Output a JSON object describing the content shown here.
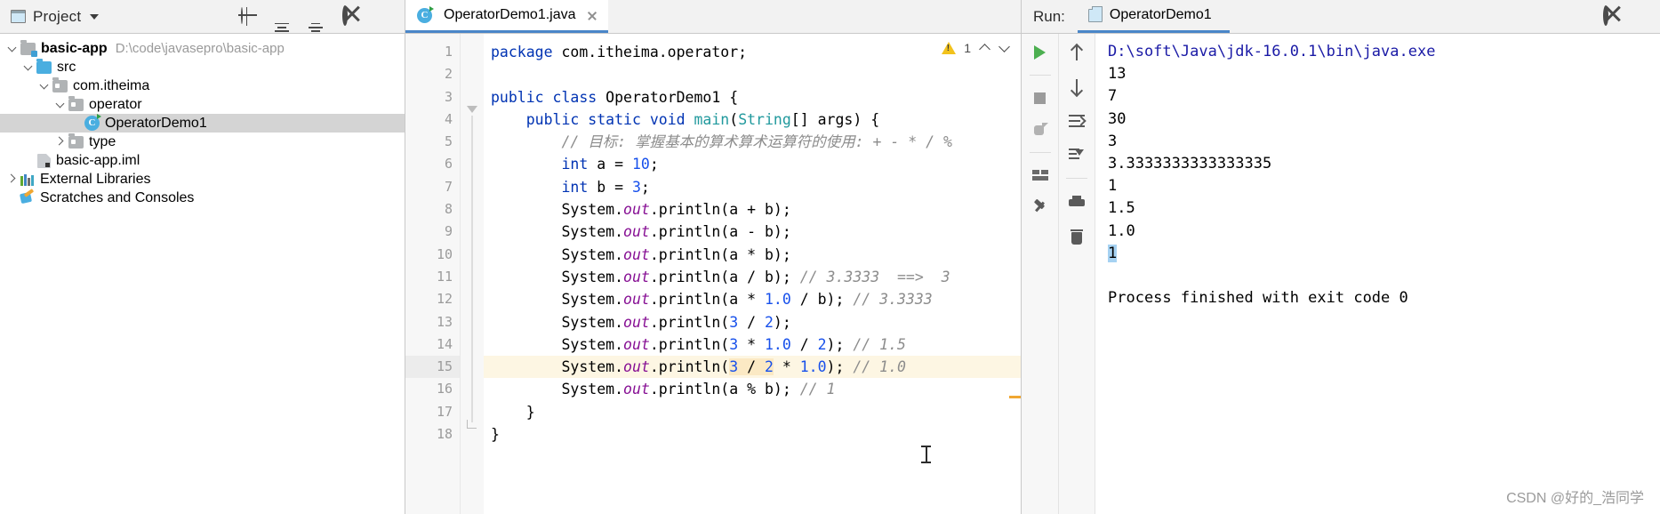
{
  "project_panel": {
    "title": "Project",
    "icons": [
      "window-icon",
      "chevron-down-icon",
      "locate-icon",
      "expand-all-icon",
      "collapse-all-icon",
      "gear-icon",
      "hide-icon"
    ],
    "tree": [
      {
        "label": "basic-app",
        "path": "D:\\code\\javasepro\\basic-app",
        "icon": "module-icon",
        "depth": 0,
        "expanded": true,
        "bold": true,
        "selected": false
      },
      {
        "label": "src",
        "path": "",
        "icon": "source-folder-icon",
        "depth": 1,
        "expanded": true,
        "bold": false,
        "selected": false
      },
      {
        "label": "com.itheima",
        "path": "",
        "icon": "package-icon",
        "depth": 2,
        "expanded": true,
        "bold": false,
        "selected": false
      },
      {
        "label": "operator",
        "path": "",
        "icon": "package-icon",
        "depth": 3,
        "expanded": true,
        "bold": false,
        "selected": false
      },
      {
        "label": "OperatorDemo1",
        "path": "",
        "icon": "java-class-icon",
        "depth": 4,
        "expanded": null,
        "bold": false,
        "selected": true
      },
      {
        "label": "type",
        "path": "",
        "icon": "package-icon",
        "depth": 3,
        "expanded": false,
        "bold": false,
        "selected": false
      },
      {
        "label": "basic-app.iml",
        "path": "",
        "icon": "iml-file-icon",
        "depth": 2,
        "expanded": null,
        "bold": false,
        "selected": false
      },
      {
        "label": "External Libraries",
        "path": "",
        "icon": "libraries-icon",
        "depth": 0,
        "expanded": false,
        "bold": false,
        "selected": false
      },
      {
        "label": "Scratches and Consoles",
        "path": "",
        "icon": "scratches-icon",
        "depth": 0,
        "expanded": null,
        "bold": false,
        "selected": false
      }
    ]
  },
  "editor": {
    "tab": {
      "label": "OperatorDemo1.java",
      "icon": "java-class-icon",
      "close_icon": "close-icon"
    },
    "inspection": {
      "warning_count": "1",
      "warn_icon": "warning-triangle-icon",
      "up_icon": "chevron-up-icon",
      "down_icon": "chevron-down-icon"
    },
    "lines": [
      {
        "no": "1",
        "runmark": false,
        "bulb": false,
        "current": false
      },
      {
        "no": "2",
        "runmark": false,
        "bulb": false,
        "current": false
      },
      {
        "no": "3",
        "runmark": true,
        "bulb": false,
        "current": false
      },
      {
        "no": "4",
        "runmark": true,
        "bulb": false,
        "current": false
      },
      {
        "no": "5",
        "runmark": false,
        "bulb": false,
        "current": false
      },
      {
        "no": "6",
        "runmark": false,
        "bulb": false,
        "current": false
      },
      {
        "no": "7",
        "runmark": false,
        "bulb": false,
        "current": false
      },
      {
        "no": "8",
        "runmark": false,
        "bulb": false,
        "current": false
      },
      {
        "no": "9",
        "runmark": false,
        "bulb": false,
        "current": false
      },
      {
        "no": "10",
        "runmark": false,
        "bulb": false,
        "current": false
      },
      {
        "no": "11",
        "runmark": false,
        "bulb": false,
        "current": false
      },
      {
        "no": "12",
        "runmark": false,
        "bulb": false,
        "current": false
      },
      {
        "no": "13",
        "runmark": false,
        "bulb": false,
        "current": false
      },
      {
        "no": "14",
        "runmark": false,
        "bulb": false,
        "current": false
      },
      {
        "no": "15",
        "runmark": false,
        "bulb": true,
        "current": true
      },
      {
        "no": "16",
        "runmark": false,
        "bulb": false,
        "current": false
      },
      {
        "no": "17",
        "runmark": false,
        "bulb": false,
        "current": false
      },
      {
        "no": "18",
        "runmark": false,
        "bulb": false,
        "current": false
      }
    ],
    "code_text": [
      "package com.itheima.operator;",
      "",
      "public class OperatorDemo1 {",
      "    public static void main(String[] args) {",
      "        // 目标: 掌握基本的算术算术运算符的使用: + - * / %",
      "        int a = 10;",
      "        int b = 3;",
      "        System.out.println(a + b);",
      "        System.out.println(a - b);",
      "        System.out.println(a * b);",
      "        System.out.println(a / b); // 3.3333  ==>  3",
      "        System.out.println(a * 1.0 / b); // 3.3333",
      "        System.out.println(3 / 2);",
      "        System.out.println(3 * 1.0 / 2); // 1.5",
      "        System.out.println(3 / 2 * 1.0); // 1.0",
      "        System.out.println(a % b); // 1",
      "    }",
      "}"
    ]
  },
  "run_panel": {
    "label": "Run:",
    "tab": {
      "label": "OperatorDemo1",
      "icon": "run-config-icon",
      "close_icon": "close-icon"
    },
    "header_icons": [
      "gear-icon",
      "hide-icon"
    ],
    "toolbar_left": [
      "run-icon",
      "stop-icon",
      "rerun-failed-icon",
      "layout-icon",
      "pin-icon"
    ],
    "toolbar_right": [
      "up-arrow-icon",
      "down-arrow-icon",
      "soft-wrap-icon",
      "scroll-to-end-icon",
      "print-icon",
      "trash-icon"
    ],
    "console_lines": [
      {
        "text": "D:\\soft\\Java\\jdk-16.0.1\\bin\\java.exe",
        "style": "path"
      },
      {
        "text": "13",
        "style": "plain"
      },
      {
        "text": "7",
        "style": "plain"
      },
      {
        "text": "30",
        "style": "plain"
      },
      {
        "text": "3",
        "style": "plain"
      },
      {
        "text": "3.3333333333333335",
        "style": "plain"
      },
      {
        "text": "1",
        "style": "plain"
      },
      {
        "text": "1.5",
        "style": "plain"
      },
      {
        "text": "1.0",
        "style": "plain"
      },
      {
        "text": "1",
        "style": "caret"
      },
      {
        "text": "",
        "style": "plain"
      },
      {
        "text": "Process finished with exit code 0",
        "style": "plain"
      }
    ]
  },
  "watermark": "CSDN @好的_浩同学"
}
